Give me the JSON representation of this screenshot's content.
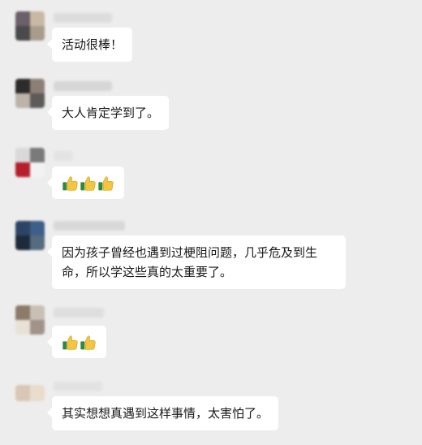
{
  "messages": [
    {
      "id": "m1",
      "text": "活动很棒！",
      "avatar_colors": [
        "#6b5f6a",
        "#c8b9a3",
        "#4a4a4a",
        "#a89c8c"
      ],
      "name_color": "#cfcfcf"
    },
    {
      "id": "m2",
      "text": "大人肯定学到了。",
      "avatar_colors": [
        "#2c2c2c",
        "#8e7f76",
        "#bdb3a9",
        "#5d5a58"
      ],
      "name_color": "#c4c4c4"
    },
    {
      "id": "m3",
      "emoji": [
        "thumbs-up",
        "thumbs-up",
        "thumbs-up"
      ],
      "avatar_colors": [
        "#d9d9d9",
        "#7a7a7a",
        "#b51f2a",
        "#f2f2f2"
      ],
      "name_color": "#dcdcdc"
    },
    {
      "id": "m4",
      "text": "因为孩子曾经也遇到过梗阻问题，几乎危及到生命，所以学这些真的太重要了。",
      "avatar_colors": [
        "#2d4466",
        "#3e5f89",
        "#1d2a3a",
        "#556b7e"
      ],
      "name_color": "#c7c7c7"
    },
    {
      "id": "m5",
      "emoji": [
        "thumbs-up",
        "thumbs-up"
      ],
      "avatar_colors": [
        "#8c7b6a",
        "#c8bfb5",
        "#e9e1d7",
        "#a0948a"
      ],
      "name_color": "#d2d2d2"
    },
    {
      "id": "m6",
      "text": "其实想想真遇到这样事情，太害怕了。",
      "avatar_colors": [
        "#d8c7b6",
        "#e9dccd",
        "#cbb8a4",
        "#e1d2c2"
      ],
      "name_color": "#dadada"
    }
  ]
}
